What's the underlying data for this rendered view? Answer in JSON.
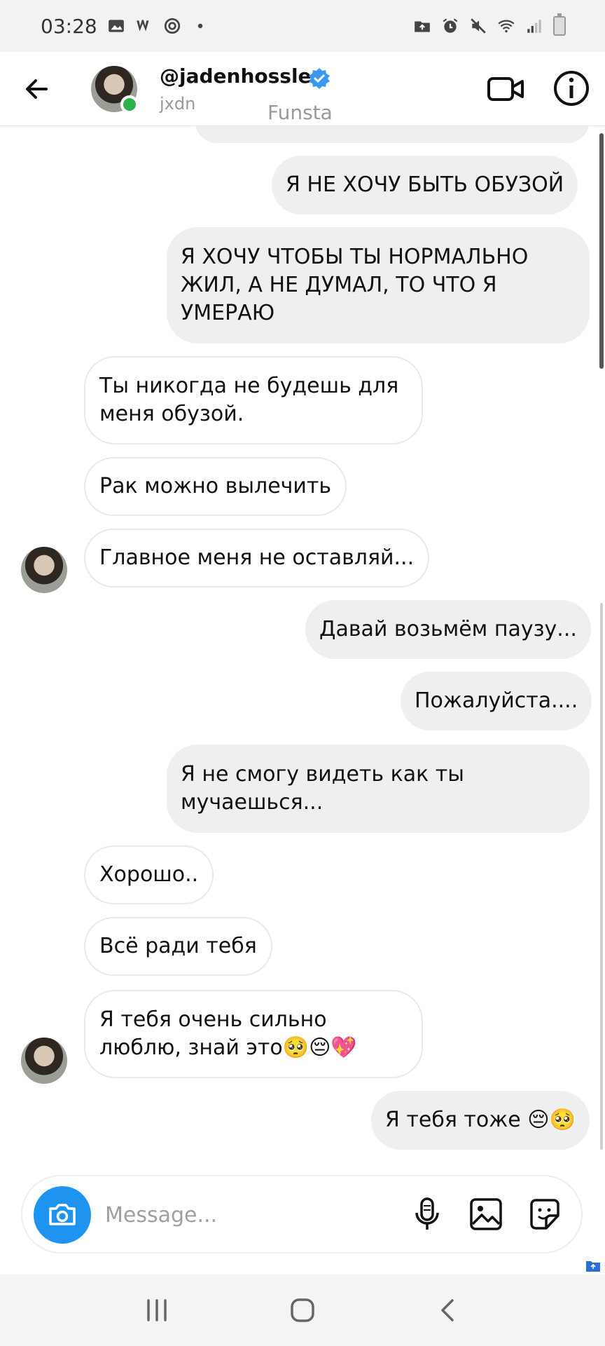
{
  "status_bar": {
    "time": "03:28",
    "left_icons": [
      "image-icon",
      "w-icon",
      "sync-icon",
      "dot-icon"
    ],
    "right_icons": [
      "folder-icon",
      "alarm-icon",
      "mute-icon",
      "wifi-icon",
      "signal-icon",
      "battery-icon"
    ]
  },
  "header": {
    "username": "@jadenhossler",
    "subtitle": "jxdn",
    "overlay_label": "Funsta",
    "verified": true,
    "online": true
  },
  "messages": [
    {
      "dir": "out",
      "text": "Я НЕ ХОЧУ БЫТЬ ОБУЗОЙ"
    },
    {
      "dir": "out",
      "text": "Я ХОЧУ ЧТОБЫ ТЫ НОРМАЛЬНО ЖИЛ, А НЕ ДУМАЛ, ТО ЧТО Я УМЕРАЮ"
    },
    {
      "dir": "in",
      "text": "Ты никогда не будешь для меня обузой."
    },
    {
      "dir": "in",
      "text": "Рак можно вылечить"
    },
    {
      "dir": "in",
      "text": "Главное меня не оставляй..."
    },
    {
      "dir": "out",
      "text": "Давай возьмём паузу..."
    },
    {
      "dir": "out",
      "text": "Пожалуйста...."
    },
    {
      "dir": "out",
      "text": "Я не смогу видеть как ты мучаешься..."
    },
    {
      "dir": "in",
      "text": "Хорошо.."
    },
    {
      "dir": "in",
      "text": "Всё ради тебя"
    },
    {
      "dir": "in",
      "text": "Я тебя очень сильно люблю, знай это🥺😔💖"
    },
    {
      "dir": "out",
      "text": "Я тебя тоже 😔🥺"
    }
  ],
  "composer": {
    "placeholder": "Message...",
    "value": ""
  },
  "nav_bar": {
    "buttons": [
      "recents-icon",
      "home-icon",
      "back-nav-icon"
    ]
  },
  "colors": {
    "accent": "#1e94f0",
    "online": "#2bb24c",
    "outgoing_bubble": "#efeff1",
    "verified": "#3897f0"
  }
}
